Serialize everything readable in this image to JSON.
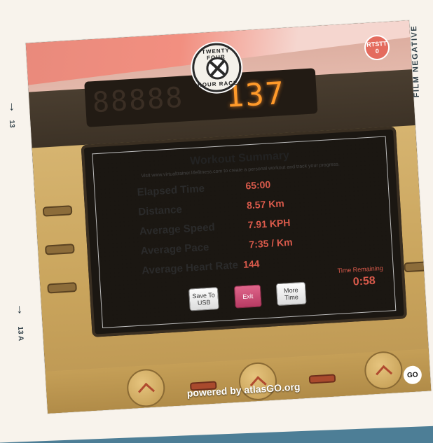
{
  "frame": {
    "side_label": "FILM NEGATIVE",
    "frame_top": "13",
    "frame_bottom": "13 A",
    "arrow": "↓"
  },
  "display": {
    "counter_dim": "88888",
    "counter_lit": "137"
  },
  "logo": {
    "top_text": "TWENTY FOUR",
    "bottom_text": "HOUR RACE",
    "corner_badge_line1": "RTSTT",
    "corner_badge_line2": "0"
  },
  "screen": {
    "title": "Workout Summary",
    "subtitle": "Visit www.virtualtrainer.lifefitness.com to create a personal workout and track your progress.",
    "rows": [
      {
        "label": "Elapsed Time",
        "value": "65:00"
      },
      {
        "label": "Distance",
        "value": "8.57 Km"
      },
      {
        "label": "Average Speed",
        "value": "7.91 KPH"
      },
      {
        "label": "Average Pace",
        "value": "7:35 / Km"
      },
      {
        "label": "Average Heart Rate",
        "value": "144"
      }
    ],
    "buttons": {
      "save_to_usb": "Save To USB",
      "exit": "Exit",
      "more_time": "More Time"
    },
    "time_remaining_label": "Time Remaining",
    "time_remaining_value": "0:58"
  },
  "footer": {
    "powered_by": "powered by atlasGO.org",
    "go_badge": "GO"
  },
  "colors": {
    "background": "#4d7e96",
    "value_red": "#d95a4b",
    "console_yellow": "#d6b470"
  }
}
